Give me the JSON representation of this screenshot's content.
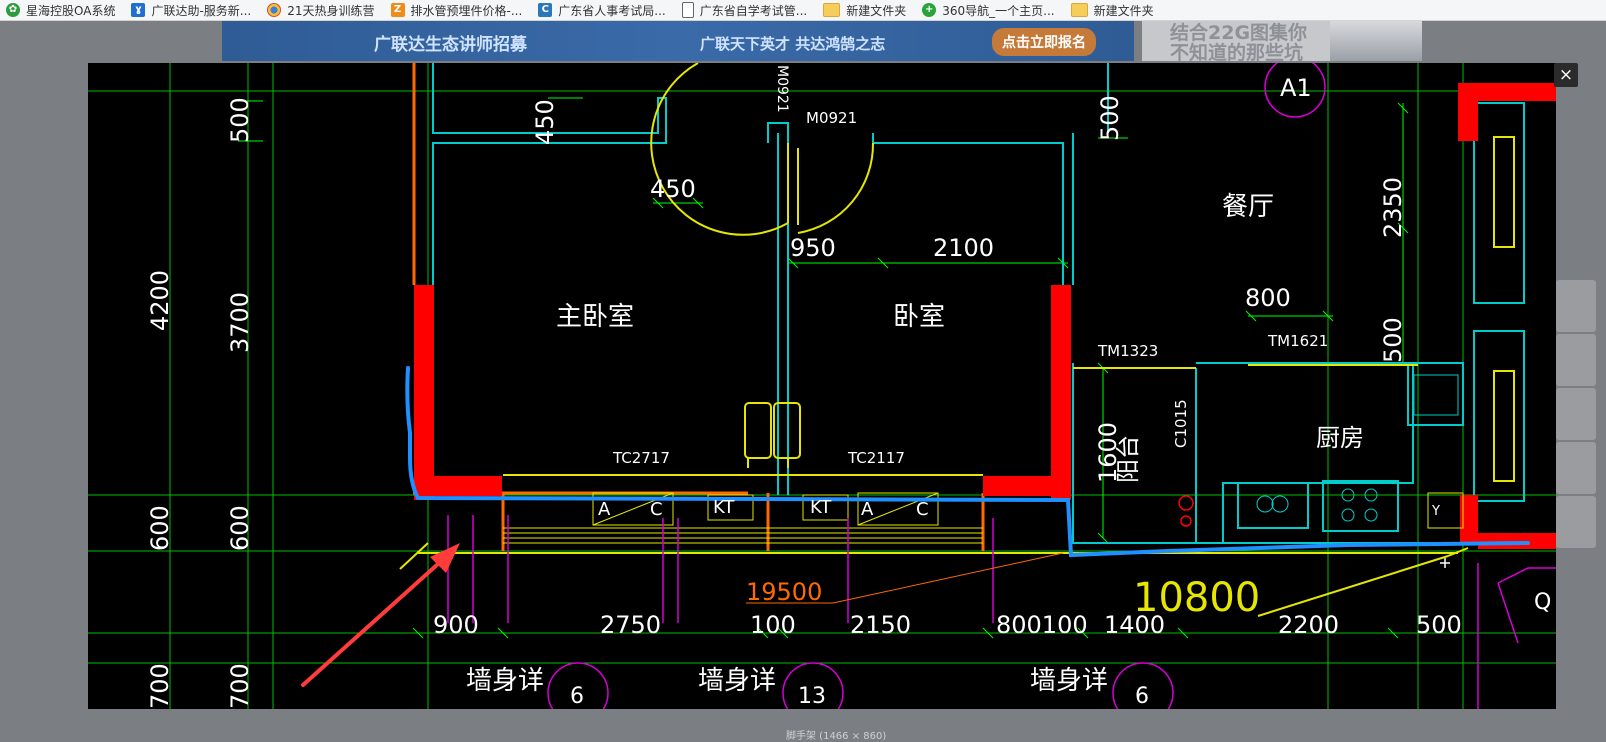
{
  "bookmarks": [
    {
      "label": "星海控股OA系统",
      "icon": "gear-icon",
      "color": "#2e9b3e"
    },
    {
      "label": "广联达助-服务新...",
      "icon": "feather-icon",
      "color": "#1e6fd0"
    },
    {
      "label": "21天热身训练营",
      "icon": "chrome-icon",
      "color": "#3b7de0"
    },
    {
      "label": "排水管预埋件价格-...",
      "icon": "square-icon",
      "color": "#f08c1a"
    },
    {
      "label": "广东省人事考试局...",
      "icon": "c-icon",
      "color": "#2a78b8"
    },
    {
      "label": "广东省自学考试管...",
      "icon": "document-icon",
      "color": "#ffffff"
    },
    {
      "label": "新建文件夹",
      "icon": "folder-icon",
      "color": "#f6cd5b"
    },
    {
      "label": "360导航_一个主页...",
      "icon": "plus-icon",
      "color": "#2aa33a"
    },
    {
      "label": "新建文件夹",
      "icon": "folder-icon",
      "color": "#f6cd5b"
    }
  ],
  "background_page": {
    "banner_title": "广联达生态讲师招募",
    "banner_slogan": "广联天下英才  共达鸿鹄之志",
    "banner_cta": "点击立即报名",
    "ad_line1": "结合22G图集你",
    "ad_line2": "不知道的那些坑",
    "bottom_caption": "脚手架 (1466 × 860)"
  },
  "viewer": {
    "close_label": "×",
    "drawing": {
      "rooms": [
        "主卧室",
        "卧室",
        "餐厅",
        "阳台",
        "厨房"
      ],
      "door_window_tags": [
        "M0921",
        "TM1323",
        "TM1621",
        "C1015",
        "TC2717",
        "TC2117",
        "A1",
        "Y"
      ],
      "dimensions_left": [
        "500",
        "4200",
        "3700",
        "600",
        "600",
        "700",
        "700"
      ],
      "dimensions_top": [
        "450",
        "450",
        "950",
        "2100",
        "800",
        "2350",
        "500",
        "1600",
        "500"
      ],
      "dimensions_bottom": [
        "900",
        "2750",
        "100",
        "2150",
        "800100",
        "1400",
        "2200",
        "500"
      ],
      "callouts": [
        "19500",
        "10800"
      ],
      "section_labels": [
        "墙身详",
        "墙身详",
        "墙身详"
      ],
      "section_numbers": [
        "6",
        "13",
        "6"
      ],
      "ac_labels": [
        "A",
        "C",
        "KT",
        "KT",
        "A",
        "C"
      ],
      "edge_marker": "Q",
      "colors": {
        "grid": "#00d400",
        "dimension": "#00ff00",
        "wall_cyan": "#00d4d4",
        "wall_red": "#ff0000",
        "annotation_blue": "#1e90ff",
        "yellow": "#ffff00",
        "orange": "#ff6a00",
        "magenta": "#d400d4",
        "arrow": "#ff3b3b",
        "text": "#ffffff"
      }
    }
  }
}
